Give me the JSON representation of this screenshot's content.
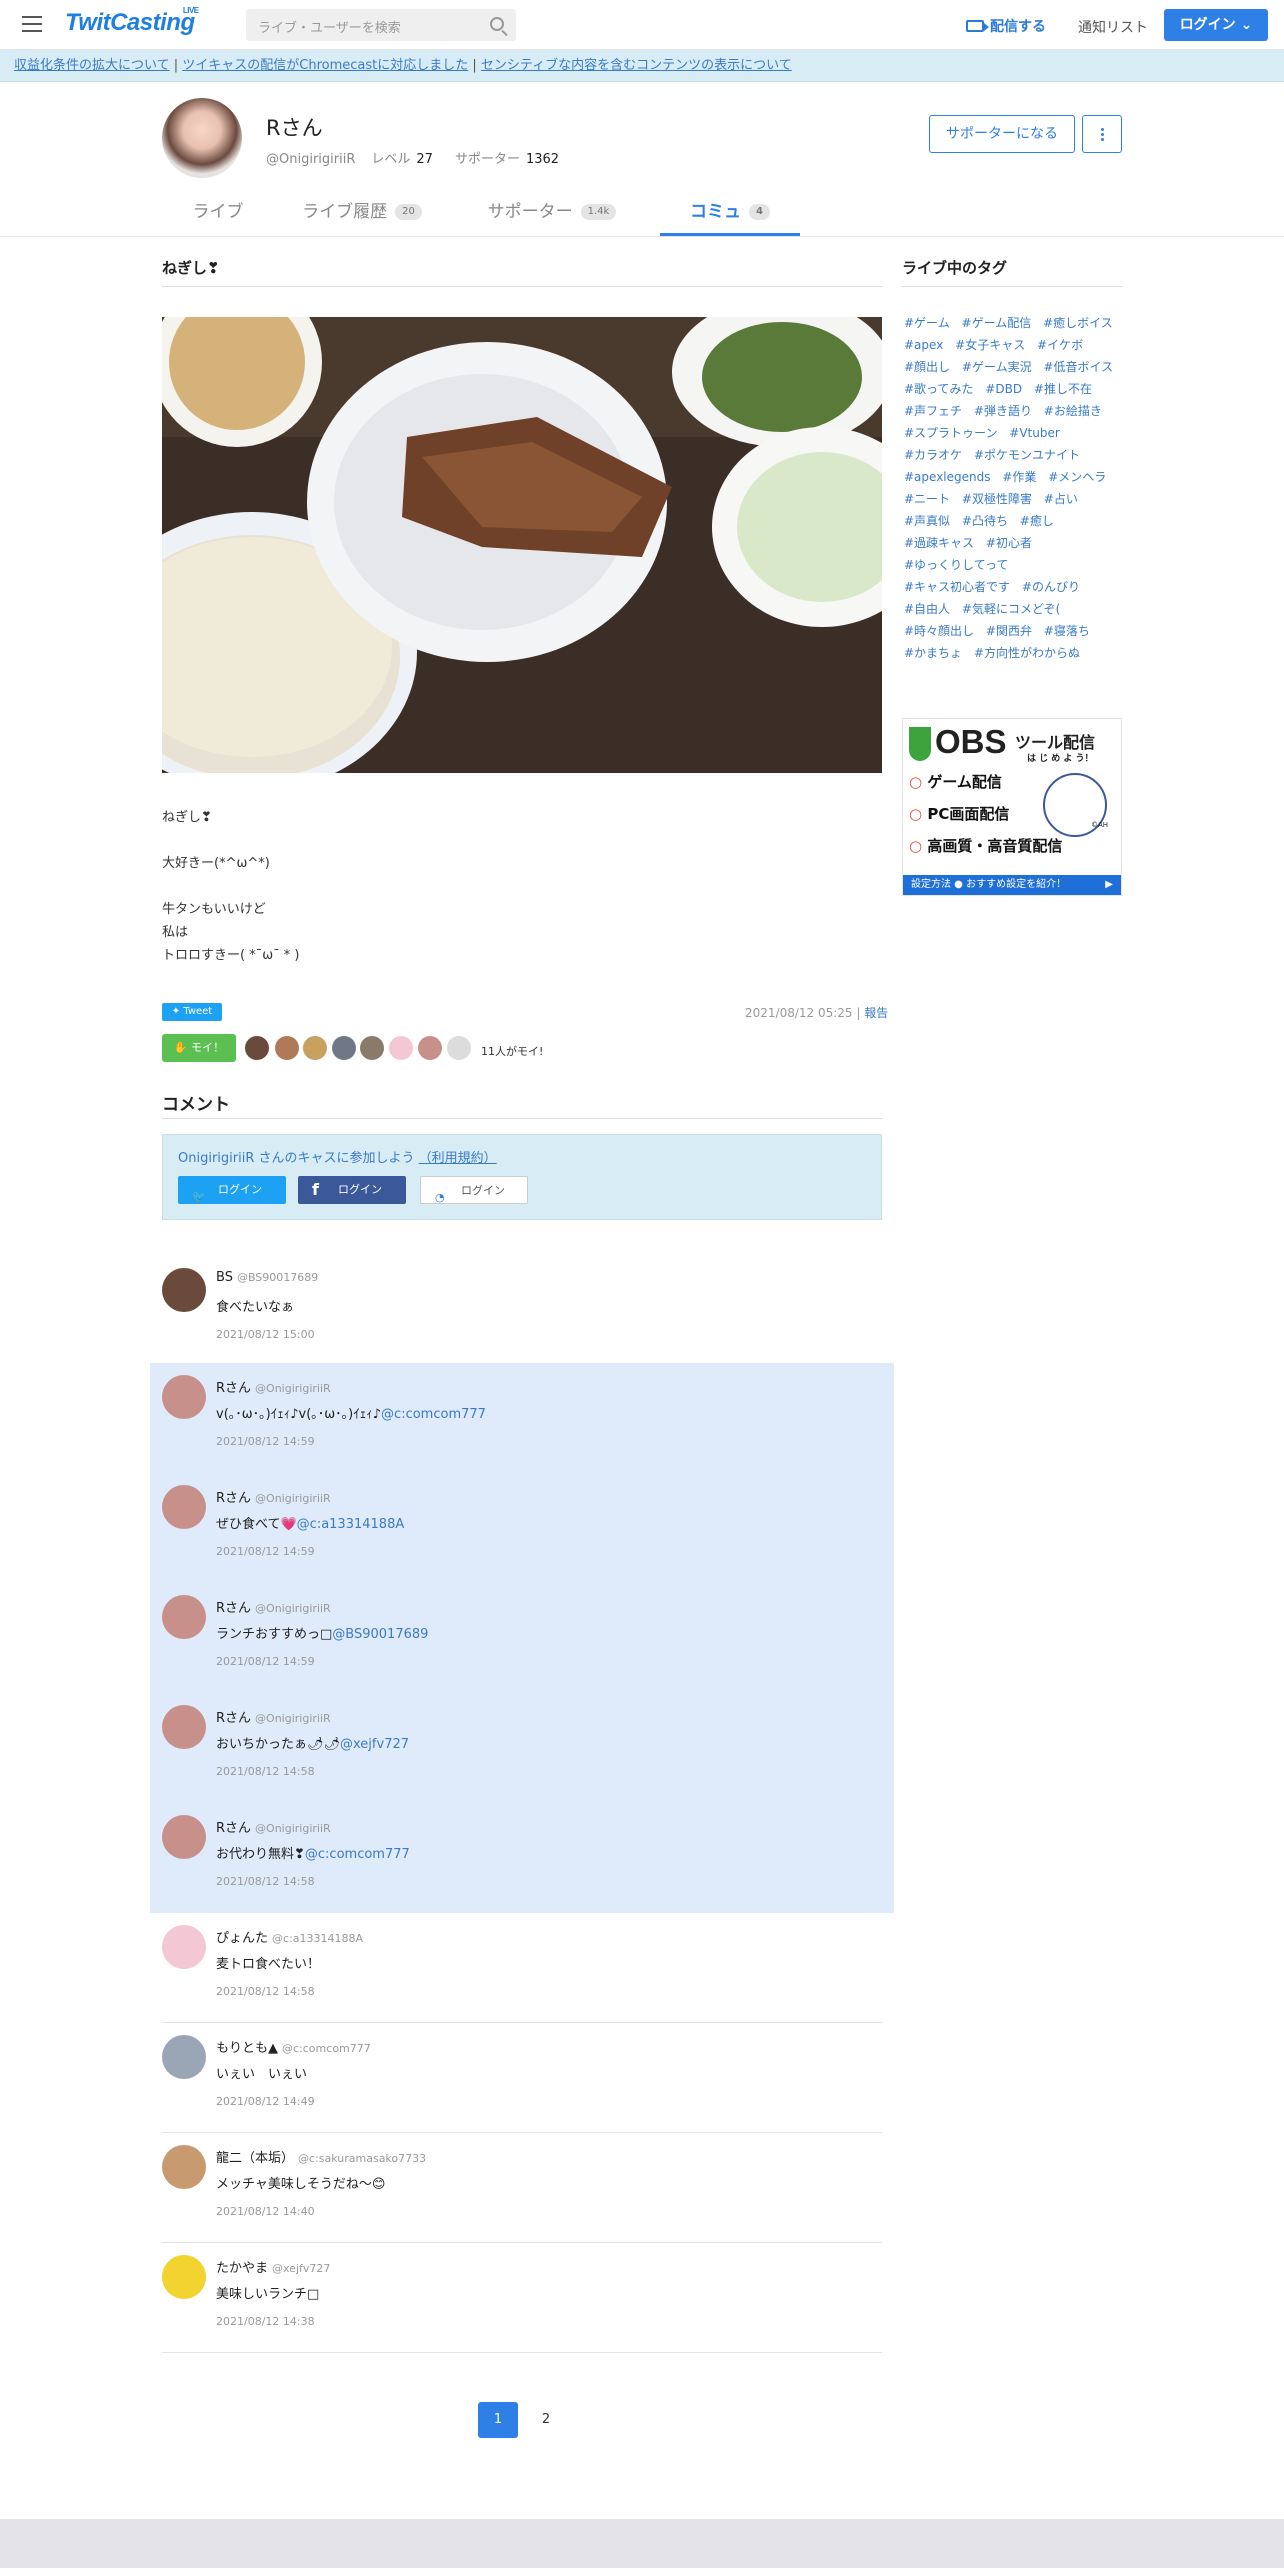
{
  "header": {
    "logo": "TwitCasting",
    "logo_sup": "LIVE",
    "search_placeholder": "ライブ・ユーザーを検索",
    "broadcast": "配信する",
    "notifications": "通知リスト",
    "login": "ログイン"
  },
  "notice": {
    "link1": "収益化条件の拡大について",
    "link2": "ツイキャスの配信がChromecastに対応しました",
    "link3": "センシティブな内容を含むコンテンツの表示について",
    "sep": " | "
  },
  "profile": {
    "name": "Rさん",
    "handle": "@OnigirigiriiR",
    "level_label": "レベル",
    "level": "27",
    "supporters_label": "サポーター",
    "supporters": "1362",
    "support_btn": "サポーターになる"
  },
  "tabs": [
    {
      "label": "ライブ",
      "count": ""
    },
    {
      "label": "ライブ履歴",
      "count": "20"
    },
    {
      "label": "サポーター",
      "count": "1.4k"
    },
    {
      "label": "コミュ",
      "count": "4"
    }
  ],
  "post": {
    "title": "ねぎし❣",
    "lines": [
      "ねぎし❣",
      "",
      "大好きー(*^ω^*)",
      "",
      "牛タンもいいけど",
      "私は",
      "トロロすきー( *¯ω¯ * )"
    ],
    "tweet": "Tweet",
    "date": "2021/08/12 05:25",
    "report": "報告",
    "moi_btn": "モイ！",
    "moi_count": "11人がモイ!"
  },
  "comments_title": "コメント",
  "join": {
    "text": "OnigirigiriiR さんのキャスに参加しよう",
    "terms": "（利用規約）",
    "twitter": "ログイン",
    "facebook": "ログイン",
    "twitcas": "ログイン"
  },
  "comments": [
    {
      "name": "BS",
      "handle": "@BS90017689",
      "text": "食べたいなぁ",
      "mention": "",
      "date": "2021/08/12 15:00",
      "hl": false,
      "color": "#6a4a3a"
    },
    {
      "name": "Rさん",
      "handle": "@OnigirigiriiR",
      "text": "v(｡･ω･｡)ｲｪｨ♪v(｡･ω･｡)ｲｪｨ♪",
      "mention": "@c:comcom777",
      "date": "2021/08/12 14:59",
      "hl": true,
      "color": "#c8908a"
    },
    {
      "name": "Rさん",
      "handle": "@OnigirigiriiR",
      "text": "ぜひ食べて💗",
      "mention": "@c:a13314188A",
      "date": "2021/08/12 14:59",
      "hl": true,
      "color": "#c8908a"
    },
    {
      "name": "Rさん",
      "handle": "@OnigirigiriiR",
      "text": "ランチおすすめっ□",
      "mention": "@BS90017689",
      "date": "2021/08/12 14:59",
      "hl": true,
      "color": "#c8908a"
    },
    {
      "name": "Rさん",
      "handle": "@OnigirigiriiR",
      "text": "おいちかったぁ🌶🌶",
      "mention": "@xejfv727",
      "date": "2021/08/12 14:58",
      "hl": true,
      "color": "#c8908a"
    },
    {
      "name": "Rさん",
      "handle": "@OnigirigiriiR",
      "text": "お代わり無料❣",
      "mention": "@c:comcom777",
      "date": "2021/08/12 14:58",
      "hl": true,
      "color": "#c8908a"
    },
    {
      "name": "ぴょんた",
      "handle": "@c:a13314188A",
      "text": "麦トロ食べたい！",
      "mention": "",
      "date": "2021/08/12 14:58",
      "hl": false,
      "color": "#f3c8d4"
    },
    {
      "name": "もりとも▲",
      "handle": "@c:comcom777",
      "text": "いぇい　いぇい",
      "mention": "",
      "date": "2021/08/12 14:49",
      "hl": false,
      "color": "#9aa5b5"
    },
    {
      "name": "龍二（本垢）",
      "handle": "@c:sakuramasako7733",
      "text": "メッチャ美味しそうだね〜😊",
      "mention": "",
      "date": "2021/08/12 14:40",
      "hl": false,
      "color": "#c89a70"
    },
    {
      "name": "たかやま",
      "handle": "@xejfv727",
      "text": "美味しいランチ□",
      "mention": "",
      "date": "2021/08/12 14:38",
      "hl": false,
      "color": "#f2d330"
    }
  ],
  "pagination": [
    "1",
    "2"
  ],
  "sidebar": {
    "title": "ライブ中のタグ",
    "tags": [
      "#ゲーム",
      "#ゲーム配信",
      "#癒しボイス",
      "#apex",
      "#女子キャス",
      "#イケボ",
      "#顔出し",
      "#ゲーム実況",
      "#低音ボイス",
      "#歌ってみた",
      "#DBD",
      "#推し不在",
      "#声フェチ",
      "#弾き語り",
      "#お絵描き",
      "#スプラトゥーン",
      "#Vtuber",
      "#カラオケ",
      "#ポケモンユナイト",
      "#apexlegends",
      "#作業",
      "#メンヘラ",
      "#ニート",
      "#双極性障害",
      "#占い",
      "#声真似",
      "#凸待ち",
      "#癒し",
      "#過疎キャス",
      "#初心者",
      "#ゆっくりしてって",
      "#キャス初心者です",
      "#のんびり",
      "#自由人",
      "#気軽にコメどぞ(",
      "#時々顔出し",
      "#関西弁",
      "#寝落ち",
      "#かまちょ",
      "#方向性がわからぬ"
    ]
  },
  "banner": {
    "title": "OBS",
    "title2": "ツール配信",
    "sub": "は じ め よ う！",
    "items": [
      "ゲーム配信",
      "PC画面配信",
      "高画質・高音質配信"
    ],
    "mark": "©AH",
    "cta": "設定方法 ● おすすめ設定を紹介！"
  }
}
